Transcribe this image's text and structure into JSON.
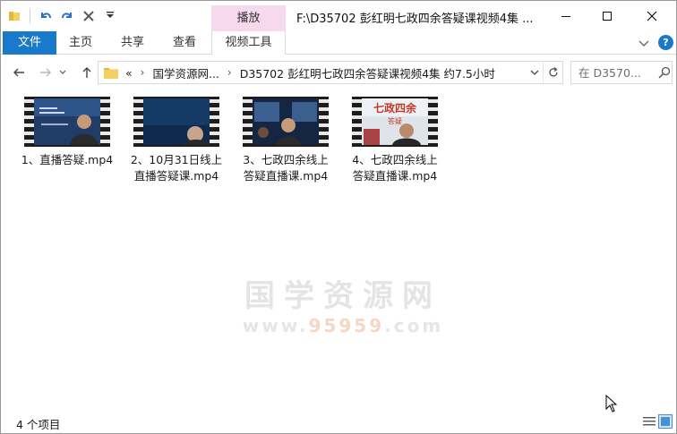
{
  "titlebar": {
    "title": "F:\\D35702 彭红明七政四余答疑课视频4集 ...",
    "context_tab_header": "播放"
  },
  "ribbon": {
    "tabs": [
      {
        "label": "文件"
      },
      {
        "label": "主页"
      },
      {
        "label": "共享"
      },
      {
        "label": "查看"
      },
      {
        "label": "视频工具"
      }
    ],
    "help_label": "?"
  },
  "address": {
    "overflow": "«",
    "crumb_parent": "国学资源网...",
    "crumb_current": "D35702 彭红明七政四余答疑课视频4集 约7.5小时"
  },
  "search": {
    "placeholder": "在 D3570..."
  },
  "files": [
    {
      "name": "1、直播答疑.mp4"
    },
    {
      "name": "2、10月31日线上直播答疑课.mp4"
    },
    {
      "name": "3、七政四余线上答疑直播课.mp4"
    },
    {
      "name": "4、七政四余线上答疑直播课.mp4"
    }
  ],
  "thumbnail_text": {
    "file4_banner": "七政四余",
    "file4_sub": "答疑"
  },
  "watermark": {
    "main": "国学资源网",
    "url_prefix": "www.",
    "url_digits": "95959",
    "url_suffix": ".com"
  },
  "status": {
    "item_count": "4 个项目"
  },
  "colors": {
    "accent": "#1979ca",
    "context_tab": "#f7d9ee"
  }
}
